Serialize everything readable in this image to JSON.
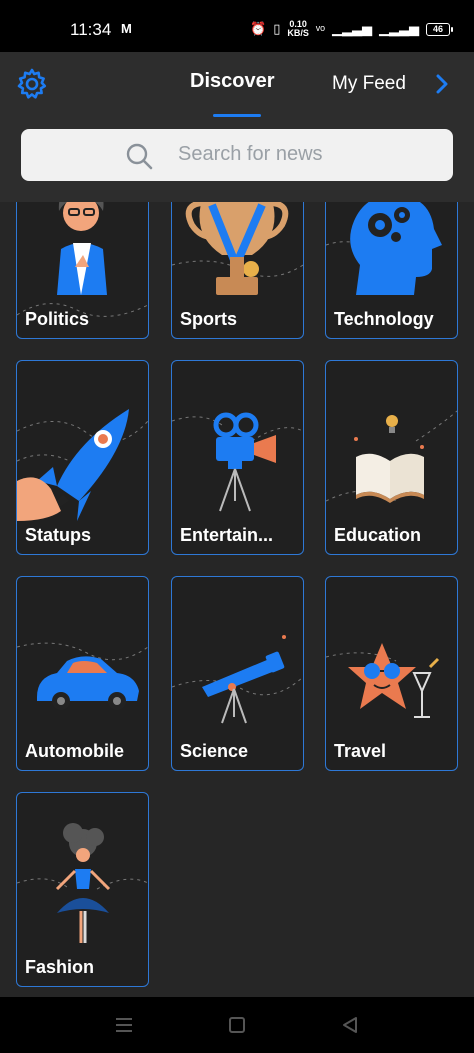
{
  "status_bar": {
    "time": "11:34",
    "mail_icon": "M",
    "speed_top": "0.10",
    "speed_bottom": "KB/S",
    "battery": "46"
  },
  "header": {
    "tabs": [
      {
        "label": "Discover",
        "active": true
      },
      {
        "label": "My Feed",
        "active": false
      }
    ]
  },
  "search": {
    "placeholder": "Search for news"
  },
  "categories": [
    {
      "label": "Politics",
      "illustration": "politician-icon"
    },
    {
      "label": "Sports",
      "illustration": "trophy-icon"
    },
    {
      "label": "Technology",
      "illustration": "head-gears-icon"
    },
    {
      "label": "Statups",
      "illustration": "rocket-icon"
    },
    {
      "label": "Entertain...",
      "illustration": "movie-camera-icon"
    },
    {
      "label": "Education",
      "illustration": "open-book-icon"
    },
    {
      "label": "Automobile",
      "illustration": "car-icon"
    },
    {
      "label": "Science",
      "illustration": "telescope-icon"
    },
    {
      "label": "Travel",
      "illustration": "starfish-sunglasses-icon"
    },
    {
      "label": "Fashion",
      "illustration": "dancer-icon"
    }
  ],
  "colors": {
    "accent": "#1d7cf2",
    "card_border": "#2e78d6",
    "background": "#262626",
    "header": "#2d2d2d"
  }
}
